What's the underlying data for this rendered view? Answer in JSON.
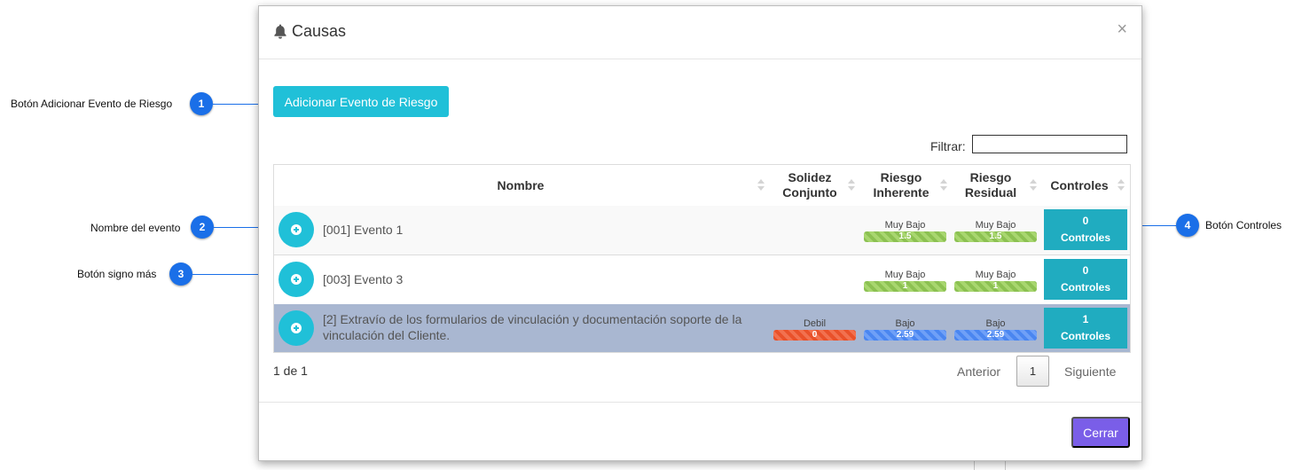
{
  "modal": {
    "title": "Causas",
    "close_label": "×",
    "add_button": "Adicionar Evento de Riesgo",
    "filter_label": "Filtrar:",
    "filter_value": "",
    "columns": [
      "Nombre",
      "Solidez Conjunto",
      "Riesgo Inherente",
      "Riesgo Residual",
      "Controles"
    ],
    "rows": [
      {
        "name": "[001] Evento 1",
        "solidez": null,
        "inherente": {
          "label": "Muy Bajo",
          "value": "1.5"
        },
        "residual": {
          "label": "Muy Bajo",
          "value": "1.5"
        },
        "controles": {
          "count": "0",
          "label": "Controles"
        }
      },
      {
        "name": "[003] Evento 3",
        "solidez": null,
        "inherente": {
          "label": "Muy Bajo",
          "value": "1"
        },
        "residual": {
          "label": "Muy Bajo",
          "value": "1"
        },
        "controles": {
          "count": "0",
          "label": "Controles"
        }
      },
      {
        "name": "[2] Extravío de los formularios de vinculación y documentación soporte de la vinculación del Cliente.",
        "solidez": {
          "label": "Debil",
          "value": "0"
        },
        "inherente": {
          "label": "Bajo",
          "value": "2.59"
        },
        "residual": {
          "label": "Bajo",
          "value": "2.59"
        },
        "controles": {
          "count": "1",
          "label": "Controles"
        }
      }
    ],
    "pager": {
      "info": "1 de 1",
      "prev": "Anterior",
      "page": "1",
      "next": "Siguiente"
    },
    "close_button": "Cerrar"
  },
  "annotations": [
    {
      "num": "1",
      "text": "Botón Adicionar Evento de Riesgo"
    },
    {
      "num": "2",
      "text": "Nombre del evento"
    },
    {
      "num": "3",
      "text": "Botón signo más"
    },
    {
      "num": "4",
      "text": "Botón Controles"
    }
  ],
  "colors": {
    "accent": "#20c0d8",
    "controls_button": "#20acc0",
    "close_button": "#7a5ee8",
    "selected_row": "#a9b7d1",
    "risk_very_low": "#8cc152",
    "risk_low": "#4a86f0",
    "weak": "#e9512a",
    "annotation": "#1a6fe8"
  }
}
